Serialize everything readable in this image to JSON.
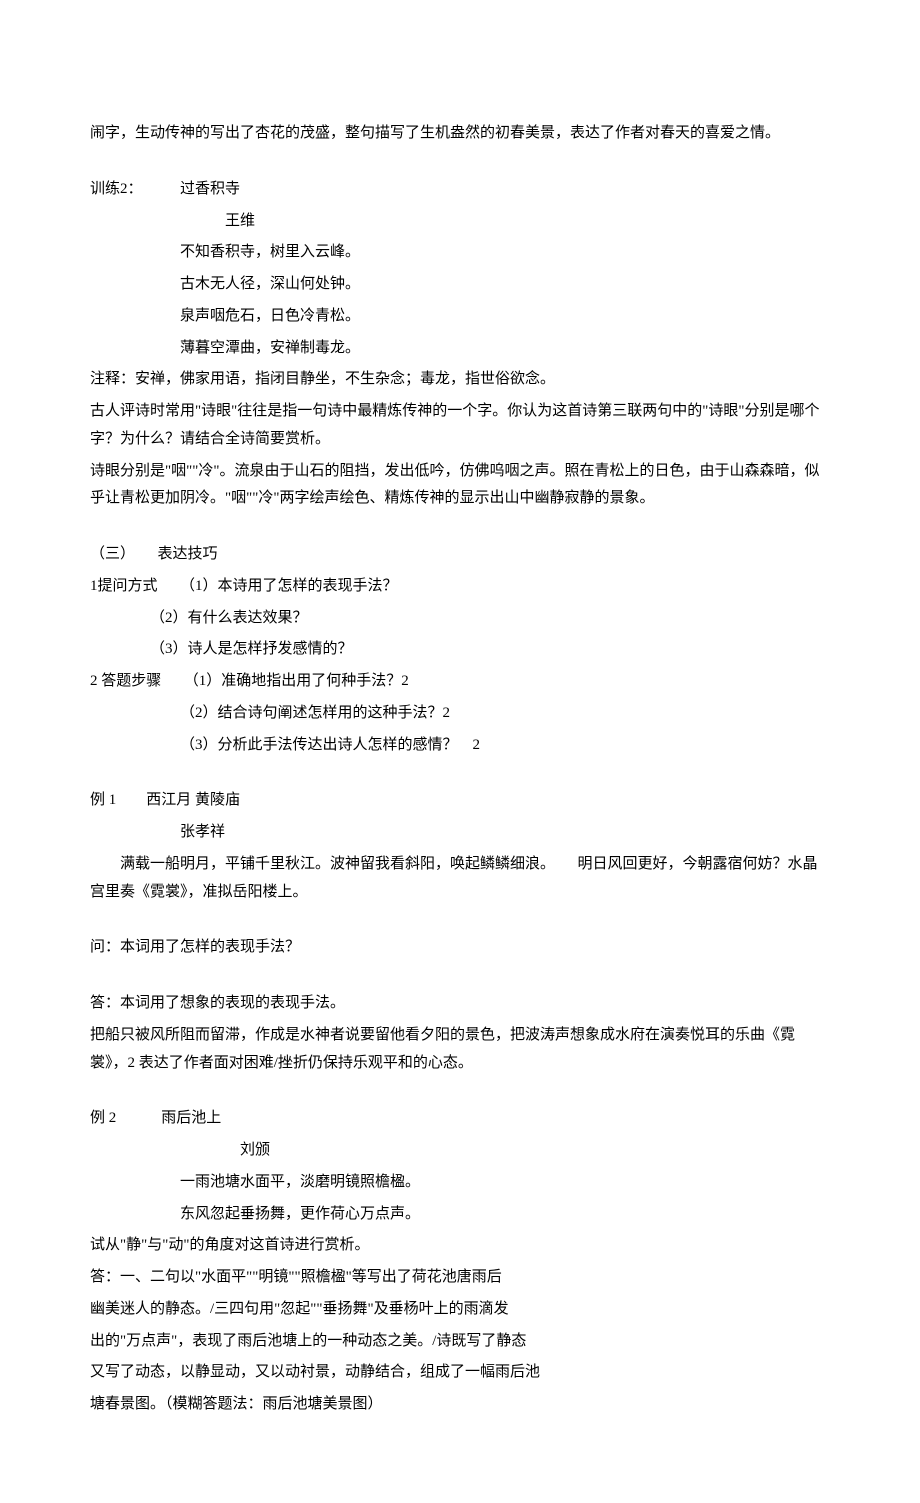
{
  "intro_line": "闹字，生动传神的写出了杏花的茂盛，整句描写了生机盎然的初春美景，表达了作者对春天的喜爱之情。",
  "ex2": {
    "title_line": "训练2：　　　过香积寺",
    "author": "王维",
    "lines": [
      "不知香积寺，树里入云峰。",
      "古木无人径，深山何处钟。",
      "泉声咽危石，日色冷青松。",
      "薄暮空潭曲，安禅制毒龙。"
    ],
    "note": "注释：安禅，佛家用语，指闭目静坐，不生杂念；毒龙，指世俗欲念。",
    "q1": "古人评诗时常用\"诗眼\"往往是指一句诗中最精炼传神的一个字。你认为这首诗第三联两句中的\"诗眼\"分别是哪个字？为什么？请结合全诗简要赏析。",
    "a1": "诗眼分别是\"咽\"\"冷\"。流泉由于山石的阻挡，发出低吟，仿佛呜咽之声。照在青松上的日色，由于山森森暗，似乎让青松更加阴冷。\"咽\"\"冷\"两字绘声绘色、精炼传神的显示出山中幽静寂静的景象。"
  },
  "section3": {
    "heading": "（三）　　表达技巧",
    "q_method_label": "1提问方式　　（1）本诗用了怎样的表现手法？",
    "q_method_2": "（2）有什么表达效果？",
    "q_method_3": "（3）诗人是怎样抒发感情的？",
    "a_step_label": "2 答题步骤　　（1）准确地指出用了何种手法？2",
    "a_step_2": "（2）结合诗句阐述怎样用的这种手法？2",
    "a_step_3": "（3）分析此手法传达出诗人怎样的感情？　2"
  },
  "ex_a": {
    "title_line": "例 1　　西江月  黄陵庙",
    "author": "张孝祥",
    "body": "满载一船明月，平铺千里秋江。波神留我看斜阳，唤起鳞鳞细浪。　　明日风回更好，今朝露宿何妨？水晶宫里奏《霓裳》，准拟岳阳楼上。",
    "q": "问：本词用了怎样的表现手法？",
    "a_head": "答：本词用了想象的表现的表现手法。",
    "a_body": "把船只被风所阻而留滞，作成是水神者说要留他看夕阳的景色，把波涛声想象成水府在演奏悦耳的乐曲《霓裳》，2 表达了作者面对困难/挫折仍保持乐观平和的心态。"
  },
  "ex_b": {
    "title_line": "例 2　　　雨后池上",
    "author": "刘颁",
    "lines": [
      "一雨池塘水面平，淡磨明镜照檐楹。",
      "东风忽起垂扬舞，更作荷心万点声。"
    ],
    "q": "试从\"静\"与\"动\"的角度对这首诗进行赏析。",
    "a_lines": [
      "答：一、二句以\"水面平\"\"明镜\"\"照檐楹\"等写出了荷花池唐雨后",
      "幽美迷人的静态。/三四句用\"忽起\"\"垂扬舞\"及垂杨叶上的雨滴发",
      "出的\"万点声\"，表现了雨后池塘上的一种动态之美。/诗既写了静态",
      "又写了动态，以静显动，又以动衬景，动静结合，组成了一幅雨后池",
      "塘春景图。（模糊答题法：雨后池塘美景图）"
    ]
  }
}
